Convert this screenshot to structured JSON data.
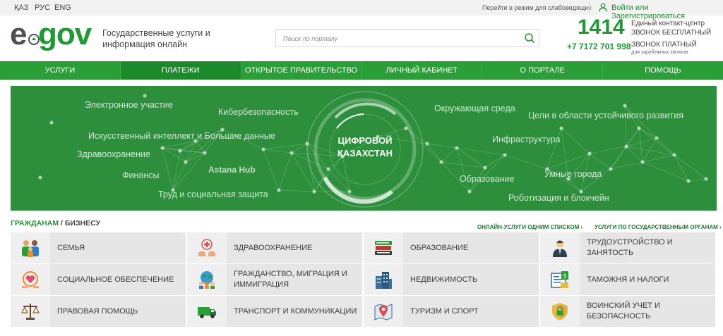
{
  "topbar": {
    "languages": [
      "ҚАЗ",
      "РУС",
      "ENG"
    ],
    "low_vision": "Перейти в режим для слабовидящих",
    "login": "Войти или Зарегистрироваться"
  },
  "header": {
    "logo_e": "e",
    "logo_gov": "gov",
    "tagline": "Государственные услуги и информация онлайн",
    "search_placeholder": "Поиск по порталу",
    "contact_number": "1414",
    "contact_title": "Единый контакт-центр",
    "contact_free": "ЗВОНОК БЕСПЛАТНЫЙ",
    "contact_phone": "+7 7172 701 998",
    "contact_paid": "ЗВОНОК ПЛАТНЫЙ",
    "contact_paid_note": "для зарубежных звонков"
  },
  "nav": {
    "items": [
      "УСЛУГИ",
      "ПЛАТЕЖИ",
      "ОТКРЫТОЕ ПРАВИТЕЛЬСТВО",
      "ЛИЧНЫЙ КАБИНЕТ",
      "О ПОРТАЛЕ",
      "ПОМОЩЬ"
    ],
    "active_index": 1
  },
  "banner": {
    "title": "ЦИФРОВОЙ КАЗАХСТАН",
    "labels": {
      "e_participation": "Электронное участие",
      "cybersecurity": "Кибербезопасность",
      "ai_bigdata": "Искусственный интеллект и Большие данные",
      "healthcare": "Здравоохранение",
      "finance": "Финансы",
      "astana_hub": "Astana Hub",
      "labor": "Труд и социальная защита",
      "environment": "Окружающая среда",
      "sdg": "Цели в области устойчивого развития",
      "infrastructure": "Инфраструктура",
      "education": "Образование",
      "smart_cities": "Умные города",
      "robotization": "Роботизация и блокчейн"
    },
    "colors": {
      "background": "#2d8f3c",
      "accent": "#1f9a32"
    }
  },
  "sections": {
    "citizens": "ГРАЖДАНАМ",
    "separator": " / ",
    "business": "БИЗНЕСУ",
    "link_services_list": "ОНЛАЙН-УСЛУГИ ОДНИМ СПИСКОМ ›",
    "link_by_agency": "УСЛУГИ ПО ГОСУДАРСТВЕННЫМ ОРГАНАМ ›"
  },
  "categories": [
    {
      "label": "Семья",
      "icon": "family-icon"
    },
    {
      "label": "Здравоохранение",
      "icon": "healthcare-icon"
    },
    {
      "label": "Образование",
      "icon": "books-icon"
    },
    {
      "label": "Трудоустройство и занятость",
      "icon": "worker-icon"
    },
    {
      "label": "Социальное обеспечение",
      "icon": "social-heart-icon"
    },
    {
      "label": "Гражданство, миграция и иммиграция",
      "icon": "globe-people-icon"
    },
    {
      "label": "Недвижимость",
      "icon": "buildings-icon"
    },
    {
      "label": "Таможня и налоги",
      "icon": "customs-icon"
    },
    {
      "label": "Правовая помощь",
      "icon": "scales-icon"
    },
    {
      "label": "Транспорт и коммуникации",
      "icon": "truck-icon"
    },
    {
      "label": "Туризм и спорт",
      "icon": "map-pin-icon"
    },
    {
      "label": "Воинский учет и безопасность",
      "icon": "shield-lock-icon"
    }
  ]
}
